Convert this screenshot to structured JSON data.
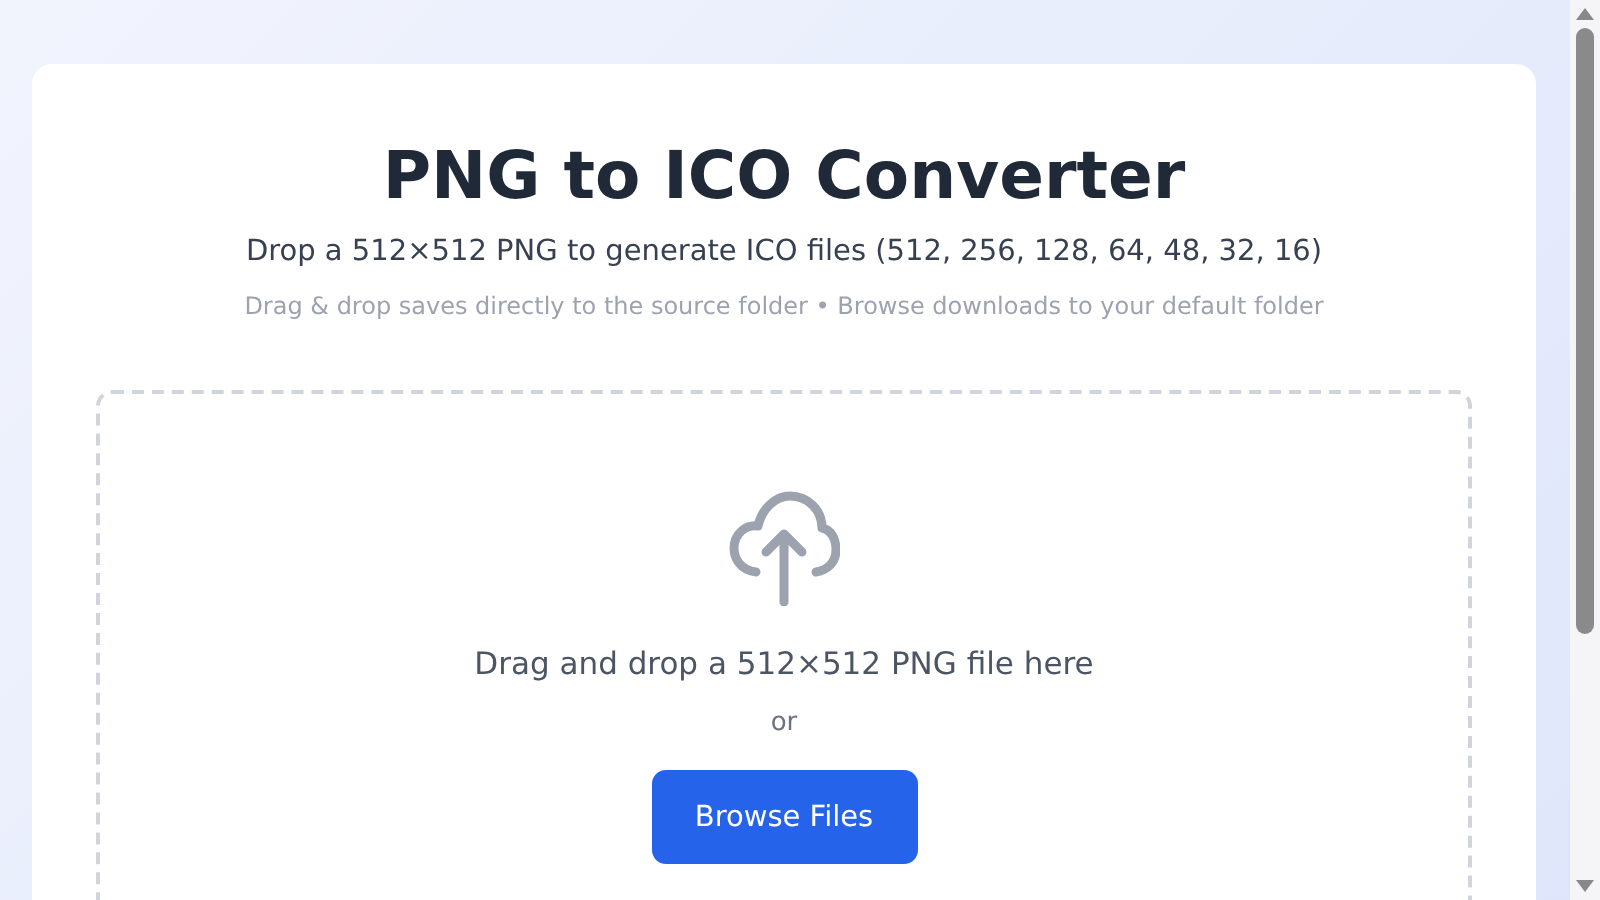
{
  "title": "PNG to ICO Converter",
  "subtitle": "Drop a 512×512 PNG to generate ICO files (512, 256, 128, 64, 48, 32, 16)",
  "hint": "Drag & drop saves directly to the source folder • Browse downloads to your default folder",
  "dropzone": {
    "prompt": "Drag and drop a 512×512 PNG file here",
    "separator": "or",
    "button": "Browse Files"
  }
}
